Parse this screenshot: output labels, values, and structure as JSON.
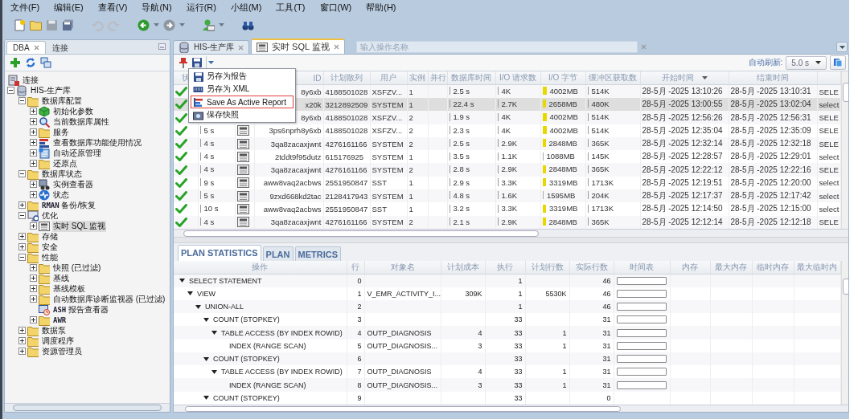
{
  "menu": [
    "文件(F)",
    "编辑(E)",
    "查看(V)",
    "导航(N)",
    "运行(R)",
    "小组(M)",
    "工具(T)",
    "窗口(W)",
    "帮助(H)"
  ],
  "navigator": {
    "tabs": [
      {
        "label": "DBA",
        "selected": true
      },
      {
        "label": "连接",
        "selected": false
      }
    ],
    "tree": [
      {
        "label": "连接",
        "kind": "connections",
        "selected": false,
        "children": [
          {
            "label": "HIS-生产库",
            "kind": "database",
            "expanded": true,
            "selected": false,
            "children": [
              {
                "label": "数据库配置",
                "kind": "folder",
                "expanded": true,
                "selected": false,
                "children": [
                  {
                    "label": "初始化参数",
                    "kind": "cube",
                    "expanded": false,
                    "selected": false
                  },
                  {
                    "label": "当前数据库属性",
                    "kind": "magnifier",
                    "expanded": false,
                    "selected": false
                  },
                  {
                    "label": "服务",
                    "kind": "folder",
                    "expanded": false,
                    "selected": false
                  },
                  {
                    "label": "查看数据库功能使用情况",
                    "kind": "chart",
                    "expanded": false,
                    "selected": false
                  },
                  {
                    "label": "自动还原管理",
                    "kind": "document",
                    "expanded": false,
                    "selected": false
                  },
                  {
                    "label": "还原点",
                    "kind": "folder",
                    "expanded": false,
                    "selected": false
                  }
                ]
              },
              {
                "label": "数据库状态",
                "kind": "folder",
                "expanded": true,
                "selected": false,
                "children": [
                  {
                    "label": "实例查看器",
                    "kind": "viewer",
                    "expanded": false,
                    "selected": false
                  },
                  {
                    "label": "状态",
                    "kind": "status",
                    "expanded": false,
                    "selected": false
                  }
                ]
              },
              {
                "label": "**RMAN** 备份/恢复",
                "kind": "folder",
                "expanded": false,
                "selected": false
              },
              {
                "label": "优化",
                "kind": "monitor",
                "expanded": true,
                "selected": false,
                "children": [
                  {
                    "label": "实时 SQL 监视",
                    "kind": "sql",
                    "expanded": false,
                    "selected": true
                  }
                ]
              },
              {
                "label": "存储",
                "kind": "folder",
                "expanded": false,
                "selected": false
              },
              {
                "label": "安全",
                "kind": "folder",
                "expanded": false,
                "selected": false
              },
              {
                "label": "性能",
                "kind": "folder",
                "expanded": true,
                "selected": false,
                "children": [
                  {
                    "label": "快照 (已过滤)",
                    "kind": "folder",
                    "expanded": false,
                    "selected": false
                  },
                  {
                    "label": "基线",
                    "kind": "folder",
                    "expanded": false,
                    "selected": false
                  },
                  {
                    "label": "基线模板",
                    "kind": "folder",
                    "expanded": false,
                    "selected": false
                  },
                  {
                    "label": "自动数据库诊断监视器 (已过滤)",
                    "kind": "folder",
                    "expanded": false,
                    "selected": false
                  },
                  {
                    "label": "**ASH** 报告查看器",
                    "kind": "report",
                    "selected": false
                  },
                  {
                    "label": "**AWR**",
                    "kind": "folder",
                    "expanded": false,
                    "selected": false
                  }
                ]
              },
              {
                "label": "数据泵",
                "kind": "folder",
                "expanded": false,
                "selected": false
              },
              {
                "label": "调度程序",
                "kind": "folder",
                "expanded": false,
                "selected": false
              },
              {
                "label": "资源管理员",
                "kind": "folder",
                "expanded": false,
                "selected": false
              }
            ]
          }
        ]
      }
    ]
  },
  "editor_tabs": [
    {
      "label": "HIS-生产库",
      "kind": "database",
      "selected": false
    },
    {
      "label": "实时 SQL 监视",
      "kind": "sql",
      "selected": true
    }
  ],
  "action_search": {
    "placeholder": "输入操作名称"
  },
  "auto_refresh": {
    "label": "自动刷新:",
    "value": "5.0 s"
  },
  "save_menu": [
    {
      "label": "另存为报告",
      "kind": "save",
      "selected": false
    },
    {
      "label": "另存为 XML",
      "kind": "xml",
      "selected": false
    },
    {
      "label": "Save As Active Report",
      "kind": "chart",
      "selected": true
    },
    {
      "label": "保存快照",
      "kind": "camera",
      "selected": false
    }
  ],
  "sql_grid": {
    "columns": [
      "状",
      "ID",
      "计划散列",
      "用户",
      "实例",
      "并行",
      "数据库时间",
      "I/O 请求数",
      "I/O 字节",
      "缓冲区获取数",
      "开始时间",
      "结束时间"
    ],
    "rows": [
      {
        "kind": "done",
        "sql_icon": false,
        "sql_id": "8y6xb",
        "plan_hash": "4188501028",
        "user": "XSFZV...",
        "instance": "1",
        "db_time": "2.5 s",
        "io_requests": "4K",
        "io_bytes": {
          "text": "4002MB",
          "level": 0.05
        },
        "buffer_gets": "514K",
        "start": "28-5月 -2025 13:10:26",
        "end": "28-5月 -2025 13:10:31",
        "sql_text": "SELE",
        "selected": false
      },
      {
        "kind": "done",
        "sql_icon": false,
        "sql_id": "x20k",
        "plan_hash": "3212892509",
        "user": "SYSTEM",
        "instance": "1",
        "db_time": "22.4 s",
        "io_requests": "2.7K",
        "io_bytes": {
          "text": "2658MB",
          "level": 0.04
        },
        "buffer_gets": "480K",
        "start": "28-5月 -2025 13:00:55",
        "end": "28-5月 -2025 13:02:04",
        "sql_text": "select",
        "selected": true
      },
      {
        "kind": "done",
        "sql_icon": false,
        "sql_id": "8y6xb",
        "plan_hash": "4188501028",
        "user": "XSFZV...",
        "instance": "2",
        "db_time": "1.9 s",
        "io_requests": "4K",
        "io_bytes": {
          "text": "4002MB",
          "level": 0.05
        },
        "buffer_gets": "514K",
        "start": "28-5月 -2025 12:56:26",
        "end": "28-5月 -2025 12:56:31",
        "sql_text": "SELE",
        "selected": false
      },
      {
        "kind": "done",
        "duration": "5 s",
        "sql_icon": true,
        "sql_id": "3ps6nprh8y6xb",
        "plan_hash": "4188501028",
        "user": "XSFZV...",
        "instance": "2",
        "db_time": "2.3 s",
        "io_requests": "4K",
        "io_bytes": {
          "text": "4002MB",
          "level": 0.05
        },
        "buffer_gets": "514K",
        "start": "28-5月 -2025 12:35:04",
        "end": "28-5月 -2025 12:35:09",
        "sql_text": "SELE",
        "selected": false
      },
      {
        "kind": "done",
        "duration": "4 s",
        "sql_icon": true,
        "sql_id": "3qa8zacaxjwnt",
        "plan_hash": "4276161166",
        "user": "SYSTEM",
        "instance": "2",
        "db_time": "2.5 s",
        "io_requests": "2.9K",
        "io_bytes": {
          "text": "2848MB",
          "level": 0.04
        },
        "buffer_gets": "365K",
        "start": "28-5月 -2025 12:32:14",
        "end": "28-5月 -2025 12:32:18",
        "sql_text": "SELE",
        "selected": false
      },
      {
        "kind": "done",
        "duration": "4 s",
        "sql_icon": true,
        "sql_id": "2tddt9f95dutz",
        "plan_hash": "615176925",
        "user": "SYSTEM",
        "instance": "1",
        "db_time": "3.5 s",
        "io_requests": "1.1K",
        "io_bytes": {
          "text": "1088MB",
          "level": 0.01
        },
        "buffer_gets": "145K",
        "start": "28-5月 -2025 12:28:57",
        "end": "28-5月 -2025 12:29:01",
        "sql_text": "select",
        "selected": false
      },
      {
        "kind": "done",
        "duration": "4 s",
        "sql_icon": true,
        "sql_id": "3qa8zacaxjwnt",
        "plan_hash": "4276161166",
        "user": "SYSTEM",
        "instance": "2",
        "db_time": "2.8 s",
        "io_requests": "2.9K",
        "io_bytes": {
          "text": "2848MB",
          "level": 0.04
        },
        "buffer_gets": "365K",
        "start": "28-5月 -2025 12:22:12",
        "end": "28-5月 -2025 12:22:16",
        "sql_text": "SELE",
        "selected": false
      },
      {
        "kind": "done",
        "duration": "9 s",
        "sql_icon": true,
        "sql_id": "aww8vaq2acbws",
        "plan_hash": "2551950847",
        "user": "SST",
        "instance": "1",
        "db_time": "2.9 s",
        "io_requests": "3.3K",
        "io_bytes": {
          "text": "3319MB",
          "level": 0.045
        },
        "buffer_gets": "1713K",
        "start": "28-5月 -2025 12:19:51",
        "end": "28-5月 -2025 12:20:00",
        "sql_text": "select",
        "selected": false
      },
      {
        "kind": "done",
        "duration": "5 s",
        "sql_icon": true,
        "sql_id": "9zxd668kd2tac",
        "plan_hash": "2128417943",
        "user": "SYSTEM",
        "instance": "1",
        "db_time": "4.8 s",
        "io_requests": "1.6K",
        "io_bytes": {
          "text": "1595MB",
          "level": 0.015
        },
        "buffer_gets": "204K",
        "start": "28-5月 -2025 12:17:37",
        "end": "28-5月 -2025 12:17:42",
        "sql_text": "select",
        "selected": false
      },
      {
        "kind": "done",
        "duration": "10 s",
        "sql_icon": true,
        "sql_id": "aww8vaq2acbws",
        "plan_hash": "2551950847",
        "user": "SST",
        "instance": "1",
        "db_time": "3.2 s",
        "io_requests": "3.3K",
        "io_bytes": {
          "text": "3319MB",
          "level": 0.045
        },
        "buffer_gets": "1713K",
        "start": "28-5月 -2025 12:14:50",
        "end": "28-5月 -2025 12:15:00",
        "sql_text": "select",
        "selected": false
      },
      {
        "kind": "done",
        "duration": "4 s",
        "sql_icon": true,
        "sql_id": "3qa8zacaxjwnt",
        "plan_hash": "4276161166",
        "user": "SYSTEM",
        "instance": "2",
        "db_time": "2.1 s",
        "io_requests": "2.9K",
        "io_bytes": {
          "text": "2848MB",
          "level": 0.04
        },
        "buffer_gets": "365K",
        "start": "28-5月 -2025 12:12:14",
        "end": "28-5月 -2025 12:12:18",
        "sql_text": "SELE",
        "selected": false
      }
    ]
  },
  "plan_tabs": [
    {
      "label": "PLAN STATISTICS",
      "selected": true
    },
    {
      "label": "PLAN",
      "selected": false
    },
    {
      "label": "METRICS",
      "selected": false
    }
  ],
  "plan_grid": {
    "columns": [
      "操作",
      "行",
      "对象名",
      "计划成本",
      "执行",
      "计划行数",
      "实际行数",
      "时间表",
      "内存",
      "最大内存",
      "临时内存",
      "最大临时内"
    ],
    "rows": [
      {
        "operation": "SELECT STATEMENT",
        "line": "0",
        "executions": "1",
        "actual_rows": "46",
        "timeline": true,
        "expanded": true,
        "children": [
          {
            "operation": "VIEW",
            "line": "1",
            "object": "V_EMR_ACTIVITY_I...",
            "cost": "309K",
            "executions": "1",
            "est_rows": "5530K",
            "actual_rows": "46",
            "timeline": true,
            "expanded": true,
            "children": [
              {
                "operation": "UNION-ALL",
                "line": "2",
                "executions": "1",
                "actual_rows": "46",
                "timeline": true,
                "expanded": true,
                "children": [
                  {
                    "operation": "COUNT (STOPKEY)",
                    "line": "3",
                    "executions": "33",
                    "actual_rows": "31",
                    "timeline": true,
                    "expanded": true,
                    "children": [
                      {
                        "operation": "TABLE ACCESS (BY INDEX ROWID)",
                        "line": "4",
                        "object": "OUTP_DIAGNOSIS",
                        "cost": "4",
                        "executions": "33",
                        "est_rows": "1",
                        "actual_rows": "31",
                        "timeline": true,
                        "expanded": true,
                        "children": [
                          {
                            "operation": "INDEX (RANGE SCAN)",
                            "line": "5",
                            "object": "OUTP_DIAGNOSIS...",
                            "cost": "3",
                            "executions": "33",
                            "est_rows": "1",
                            "actual_rows": "31",
                            "timeline": true
                          }
                        ]
                      }
                    ]
                  },
                  {
                    "operation": "COUNT (STOPKEY)",
                    "line": "6",
                    "executions": "33",
                    "actual_rows": "31",
                    "timeline": true,
                    "expanded": true,
                    "children": [
                      {
                        "operation": "TABLE ACCESS (BY INDEX ROWID)",
                        "line": "7",
                        "object": "OUTP_DIAGNOSIS",
                        "cost": "4",
                        "executions": "33",
                        "est_rows": "1",
                        "actual_rows": "31",
                        "timeline": true,
                        "expanded": true,
                        "children": [
                          {
                            "operation": "INDEX (RANGE SCAN)",
                            "line": "8",
                            "object": "OUTP_DIAGNOSIS...",
                            "cost": "3",
                            "executions": "33",
                            "est_rows": "1",
                            "actual_rows": "31",
                            "timeline": true
                          }
                        ]
                      }
                    ]
                  },
                  {
                    "operation": "COUNT (STOPKEY)",
                    "line": "9",
                    "executions": "33",
                    "actual_rows": "0",
                    "timeline": false,
                    "expanded": true
                  }
                ]
              }
            ]
          }
        ]
      }
    ]
  }
}
